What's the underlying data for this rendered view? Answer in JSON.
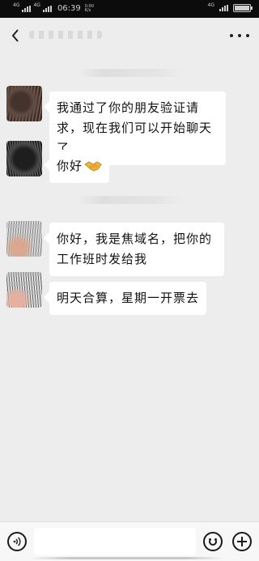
{
  "status_bar": {
    "network_left": "4G",
    "network_left2": "4G",
    "time": "06:39",
    "speed_value": "0.00",
    "speed_unit": "K/s",
    "network_right": "4G",
    "battery_level": 1.0
  },
  "nav": {
    "back_icon": "chevron-left-icon",
    "more_icon": "more-dots-icon"
  },
  "messages": [
    {
      "sender": "contact",
      "text": "我通过了你的朋友验证请求，现在我们可以开始聊天了"
    },
    {
      "sender": "contact",
      "text": "你好",
      "emoji": "handshake"
    },
    {
      "sender": "contact",
      "text": "你好，我是焦域名，把你的工作班时发给我"
    },
    {
      "sender": "contact",
      "text": "明天合算，星期一开票去"
    }
  ],
  "input_bar": {
    "voice_icon": "voice-icon",
    "input_value": "",
    "emoji_icon": "emoji-icon",
    "plus_icon": "plus-icon"
  },
  "colors": {
    "chat_background": "#ededed",
    "bubble": "#ffffff",
    "status_bar": "#0c0c0c"
  }
}
